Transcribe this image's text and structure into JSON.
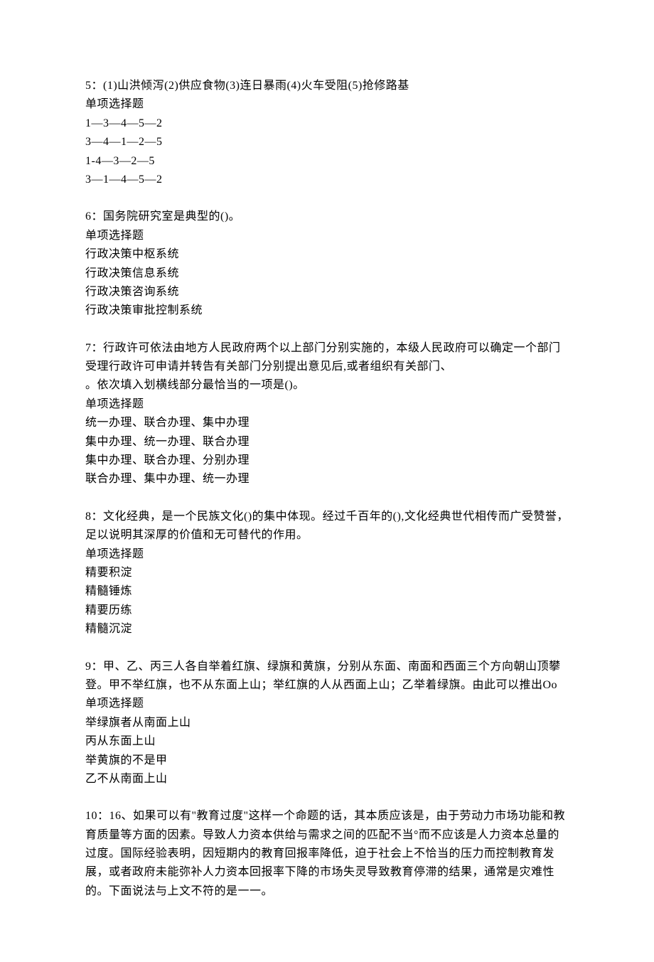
{
  "questions": [
    {
      "number": "5",
      "text": "5：(1)山洪倾泻(2)供应食物(3)连日暴雨(4)火车受阻(5)抢修路基",
      "type": "单项选择题",
      "options": [
        "1—3—4—5—2",
        "3—4—1—2—5",
        "1-4—3—2—5",
        "3—1—4—5—2"
      ]
    },
    {
      "number": "6",
      "text": "6：国务院研究室是典型的()。",
      "type": "单项选择题",
      "options": [
        "行政决策中枢系统",
        "行政决策信息系统",
        "行政决策咨询系统",
        "行政决策审批控制系统"
      ]
    },
    {
      "number": "7",
      "text": "7：行政许可依法由地方人民政府两个以上部门分别实施的，本级人民政府可以确定一个部门受理行政许可申请并转告有关部门分别提出意见后,或者组织有关部门、",
      "text2": "。依次填入划横线部分最恰当的一项是()。",
      "type": "单项选择题",
      "options": [
        "统一办理、联合办理、集中办理",
        "集中办理、统一办理、联合办理",
        "集中办理、联合办理、分别办理",
        "联合办理、集中办理、统一办理"
      ]
    },
    {
      "number": "8",
      "text": "8：文化经典，是一个民族文化()的集中体现。经过千百年的(),文化经典世代相传而广受赞誉，足以说明其深厚的价值和无可替代的作用。",
      "type": "单项选择题",
      "options": [
        "精要积淀",
        "精髓锤炼",
        "精要历练",
        "精髓沉淀"
      ]
    },
    {
      "number": "9",
      "text": "9：甲、乙、丙三人各自举着红旗、绿旗和黄旗，分别从东面、南面和西面三个方向朝山顶攀登。甲不举红旗，也不从东面上山；举红旗的人从西面上山；乙举着绿旗。由此可以推出Oo",
      "type": "单项选择题",
      "options": [
        "举绿旗者从南面上山",
        "丙从东面上山",
        "举黄旗的不是甲",
        "乙不从南面上山"
      ]
    },
    {
      "number": "10",
      "text": "10：16、如果可以有\"教育过度\"这样一个命题的话，其本质应该是，由于劳动力市场功能和教育质量等方面的因素。导致人力资本供给与需求之间的匹配不当°而不应该是人力资本总量的过度。国际经验表明，因短期内的教育回报率降低，迫于社会上不恰当的压力而控制教育发展，或者政府未能弥补人力资本回报率下降的市场失灵导致教育停滞的结果，通常是灾难性的。下面说法与上文不符的是一一。",
      "type": "",
      "options": []
    }
  ]
}
